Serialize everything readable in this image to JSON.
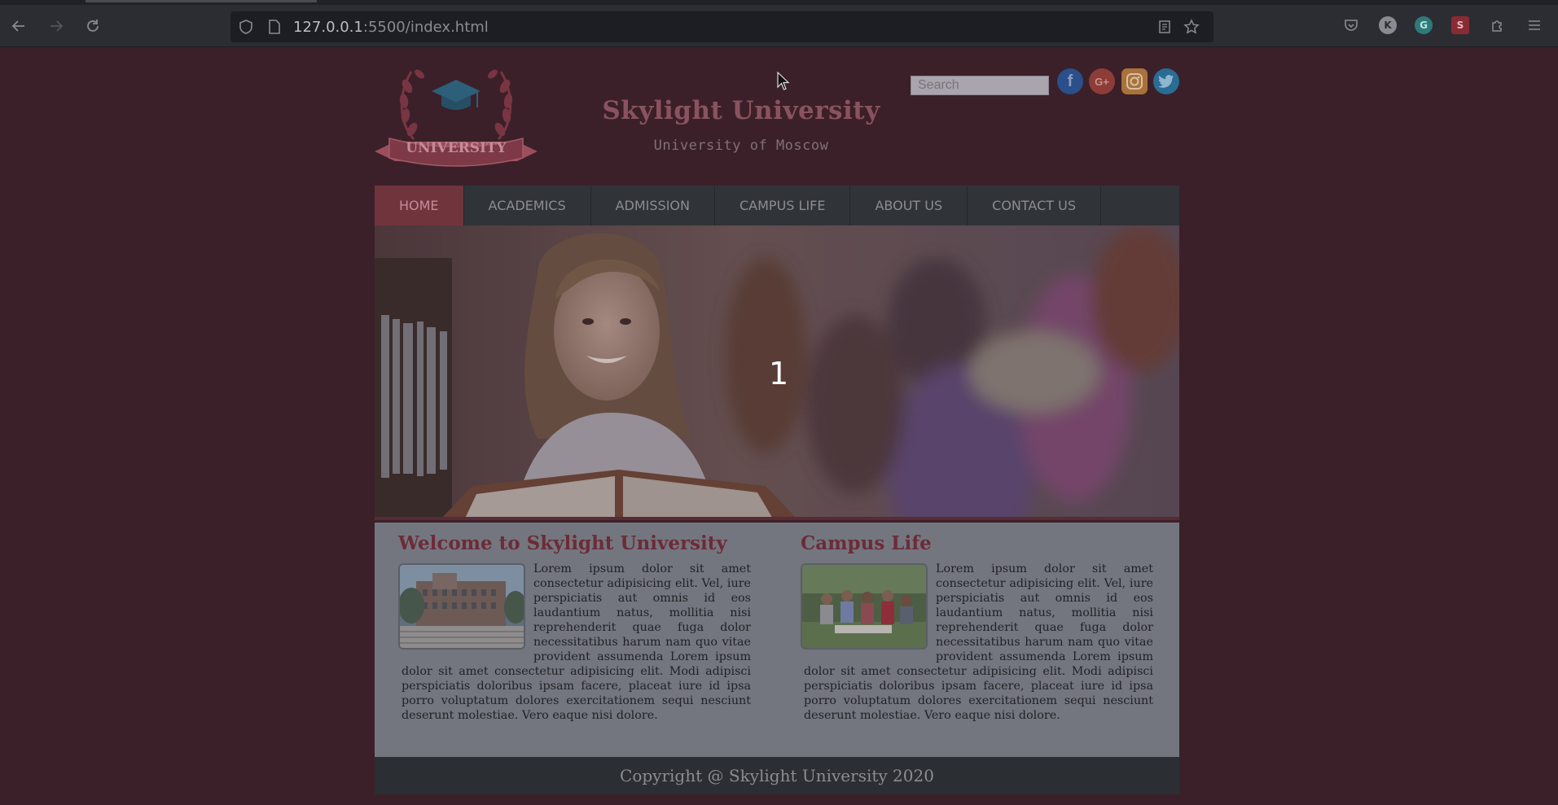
{
  "browser": {
    "url_host": "127.0.0.1",
    "url_rest": ":5500/index.html"
  },
  "header": {
    "logo_text": "UNIVERSITY",
    "title": "Skylight University",
    "subtitle": "University of Moscow",
    "search_placeholder": "Search"
  },
  "nav": {
    "items": [
      "HOME",
      "ACADEMICS",
      "ADMISSION",
      "CAMPUS LIFE",
      "ABOUT US",
      "CONTACT US"
    ]
  },
  "hero": {
    "slide_number": "1"
  },
  "sections": [
    {
      "heading": "Welcome to Skylight University",
      "body": "Lorem ipsum dolor sit amet consectetur adipisicing elit. Vel, iure perspiciatis aut omnis id eos laudantium natus, mollitia nisi reprehenderit quae fuga dolor necessitatibus harum nam quo vitae provident assumenda Lorem ipsum dolor sit amet consectetur adipisicing elit. Modi adipisci perspiciatis doloribus ipsam facere, placeat iure id ipsa porro voluptatum dolores exercitationem sequi nesciunt deserunt molestiae. Vero eaque nisi dolore."
    },
    {
      "heading": "Campus Life",
      "body": "Lorem ipsum dolor sit amet consectetur adipisicing elit. Vel, iure perspiciatis aut omnis id eos laudantium natus, mollitia nisi reprehenderit quae fuga dolor necessitatibus harum nam quo vitae provident assumenda Lorem ipsum dolor sit amet consectetur adipisicing elit. Modi adipisci perspiciatis doloribus ipsam facere, placeat iure id ipsa porro voluptatum dolores exercitationem sequi nesciunt deserunt molestiae. Vero eaque nisi dolore."
    }
  ],
  "footer": {
    "text": "Copyright @ Skylight University 2020"
  },
  "colors": {
    "page_bg": "#3b2029",
    "accent": "#70343c",
    "menu_bg": "#303338"
  },
  "icons": {
    "social": [
      "facebook-icon",
      "google-plus-icon",
      "instagram-icon",
      "twitter-icon"
    ],
    "extensions": [
      "pocket-icon",
      "k-extension-icon",
      "grammarly-icon",
      "s-extension-icon",
      "puzzle-icon"
    ]
  }
}
